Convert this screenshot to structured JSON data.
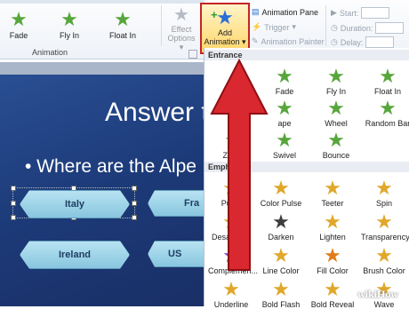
{
  "ribbon": {
    "effects": [
      {
        "label": "Fade"
      },
      {
        "label": "Fly In"
      },
      {
        "label": "Float In"
      }
    ],
    "effect_options": {
      "line1": "Effect",
      "line2": "Options"
    },
    "group_label": "Animation",
    "add_animation": {
      "line1": "Add",
      "line2": "Animation"
    },
    "advanced": {
      "animation_pane": "Animation Pane",
      "trigger": "Trigger",
      "animation_painter": "Animation Painter"
    },
    "timing": {
      "start": "Start:",
      "duration": "Duration:",
      "delay": "Delay:"
    }
  },
  "slide": {
    "title": "Answer t",
    "bullet": "• Where are the Alpe",
    "buttons": [
      "Italy",
      "Fra",
      "Ireland",
      "US"
    ]
  },
  "gallery": {
    "entrance_header": "Entrance",
    "emphasis_header": "Emphasis",
    "entrance": [
      "Fade",
      "Fly In",
      "Float In",
      "ape",
      "Wheel",
      "Random Bar",
      "Zoom",
      "Swivel",
      "Bounce"
    ],
    "emphasis": [
      "Pulse",
      "Color Pulse",
      "Teeter",
      "Spin",
      "Desaturate",
      "Darken",
      "Lighten",
      "Transparency",
      "Complemen...",
      "Line Color",
      "Fill Color",
      "Brush Color",
      "Underline",
      "Bold Flash",
      "Bold Reveal",
      "Wave"
    ]
  },
  "watermark": "wikiHow",
  "colors": {
    "highlight": "#c42424",
    "arrow": "#d9282f",
    "slide_bg": "#1f3f7f"
  }
}
